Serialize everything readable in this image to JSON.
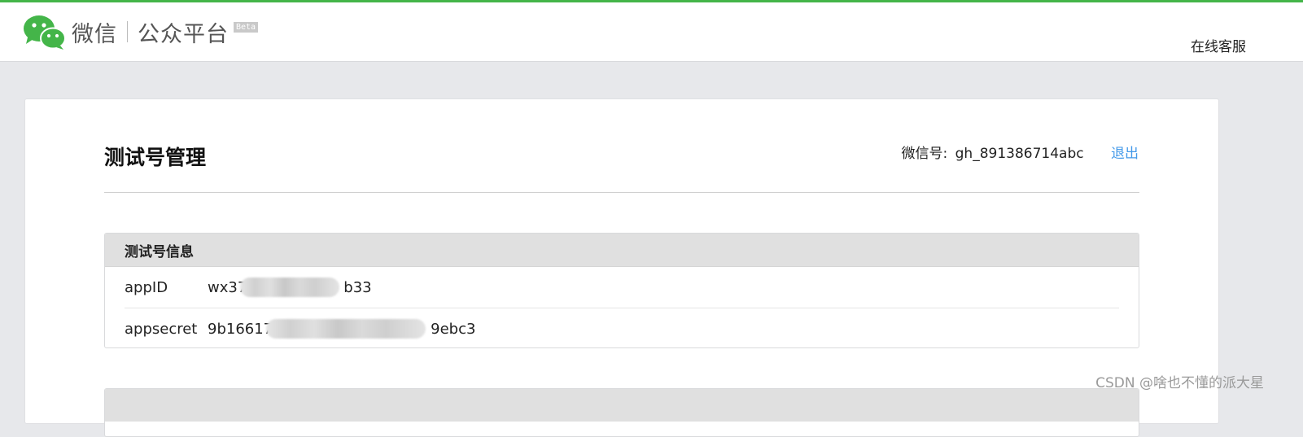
{
  "header": {
    "brand_name": "微信",
    "product_name": "公众平台",
    "beta_badge": "Beta",
    "support_link": "在线客服",
    "logo_icon": "wechat-logo-icon",
    "accent_color": "#44b549"
  },
  "page": {
    "title": "测试号管理",
    "wechat_id_label": "微信号:",
    "wechat_id_value": "gh_891386714abc",
    "logout_label": "退出",
    "link_color": "#459ae9"
  },
  "test_account_panel": {
    "title": "测试号信息",
    "rows": [
      {
        "label": "appID",
        "value_prefix": "wx37",
        "value_suffix": "b33"
      },
      {
        "label": "appsecret",
        "value_prefix": "9b16617",
        "value_suffix": "9ebc3"
      }
    ]
  },
  "watermark": "CSDN @啥也不懂的派大星"
}
